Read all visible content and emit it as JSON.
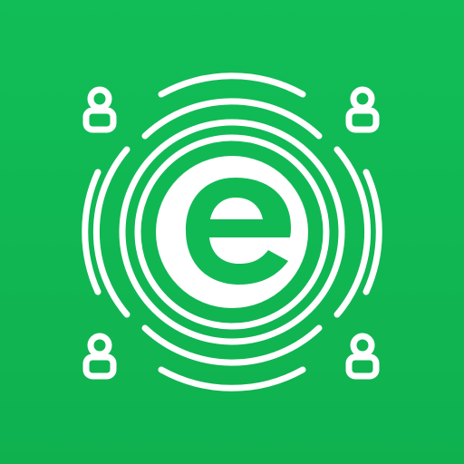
{
  "logo": {
    "description_icons": {
      "center_mark": "e-letter-icon",
      "rings": "signal-rings-icon",
      "corner_users": [
        "user-icon",
        "user-icon",
        "user-icon",
        "user-icon"
      ]
    },
    "colors": {
      "background": "#11b955",
      "foreground": "#ffffff"
    }
  }
}
